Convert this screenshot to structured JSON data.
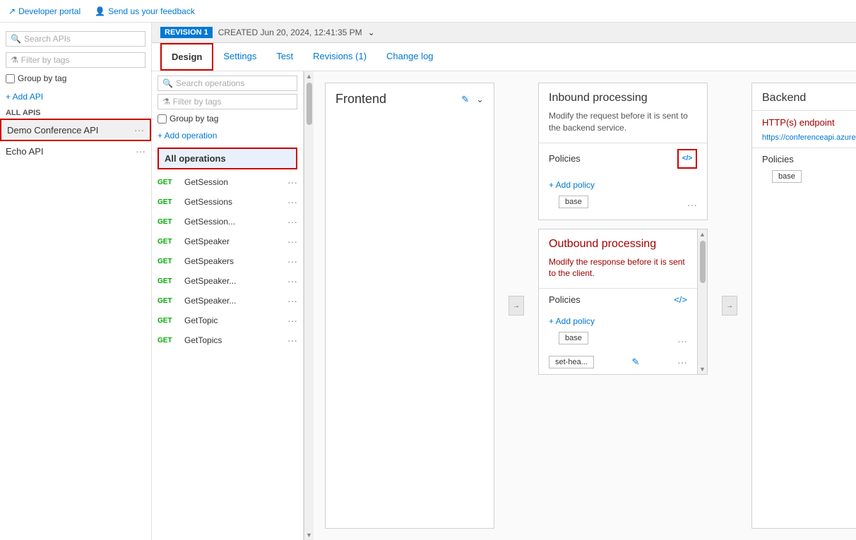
{
  "topbar": {
    "developer_portal": "Developer portal",
    "feedback": "Send us your feedback"
  },
  "left_sidebar": {
    "search_placeholder": "Search APIs",
    "filter_placeholder": "Filter by tags",
    "group_by_tag": "Group by tag",
    "add_api": "+ Add API",
    "section_label": "All APIs",
    "apis": [
      {
        "name": "Demo Conference API",
        "selected": true
      },
      {
        "name": "Echo API",
        "selected": false
      }
    ]
  },
  "revision_bar": {
    "badge": "REVISION 1",
    "created_label": "CREATED Jun 20, 2024, 12:41:35 PM"
  },
  "tabs": [
    {
      "label": "Design",
      "active": true
    },
    {
      "label": "Settings",
      "active": false
    },
    {
      "label": "Test",
      "active": false
    },
    {
      "label": "Revisions (1)",
      "active": false
    },
    {
      "label": "Change log",
      "active": false
    }
  ],
  "operations": {
    "search_placeholder": "Search operations",
    "filter_placeholder": "Filter by tags",
    "group_by_tag": "Group by tag",
    "add_operation": "+ Add operation",
    "all_operations": "All operations",
    "list": [
      {
        "method": "GET",
        "name": "GetSession"
      },
      {
        "method": "GET",
        "name": "GetSessions"
      },
      {
        "method": "GET",
        "name": "GetSession..."
      },
      {
        "method": "GET",
        "name": "GetSpeaker"
      },
      {
        "method": "GET",
        "name": "GetSpeakers"
      },
      {
        "method": "GET",
        "name": "GetSpeaker..."
      },
      {
        "method": "GET",
        "name": "GetSpeaker..."
      },
      {
        "method": "GET",
        "name": "GetTopic"
      },
      {
        "method": "GET",
        "name": "GetTopics"
      }
    ]
  },
  "frontend": {
    "title": "Frontend"
  },
  "inbound": {
    "title": "Inbound processing",
    "description": "Modify the request before it is sent to the backend service.",
    "policies_label": "Policies",
    "add_policy": "+ Add policy",
    "base_tag": "base"
  },
  "backend": {
    "title": "Backend",
    "http_endpoint_label": "HTTP(s) endpoint",
    "endpoint_url": "https://conferenceapi.azurewebsit...",
    "policies_label": "Policies",
    "base_tag": "base"
  },
  "outbound": {
    "title": "Outbound processing",
    "description": "Modify the response before it is sent to the client.",
    "policies_label": "Policies",
    "add_policy": "+ Add policy",
    "base_tag": "base",
    "set_header_tag": "set-hea..."
  },
  "icons": {
    "search": "🔍",
    "filter": "⚗",
    "checkbox": "☐",
    "plus": "+",
    "dots": "···",
    "edit": "✎",
    "chevron_down": "⌄",
    "code": "</>",
    "arrow_right": "→",
    "arrow_left": "←",
    "scroll_down": "▼",
    "scroll_up": "▲"
  }
}
